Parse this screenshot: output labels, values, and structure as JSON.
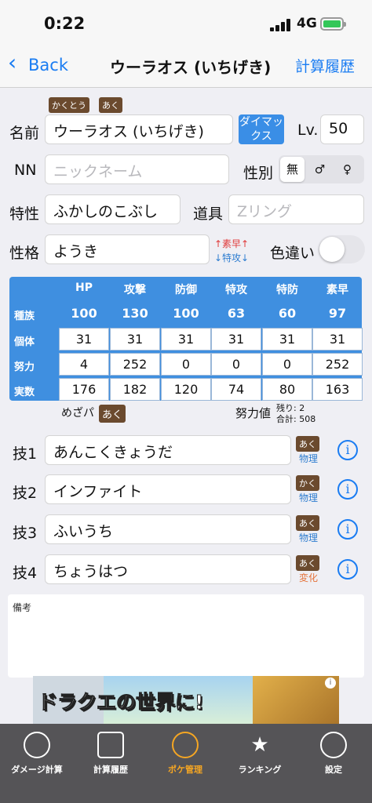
{
  "status": {
    "time": "0:22",
    "network": "4G"
  },
  "nav": {
    "back": "Back",
    "title": "ウーラオス (いちげき)",
    "right": "計算履歴"
  },
  "types": [
    "かくとう",
    "あく"
  ],
  "name": {
    "label": "名前",
    "value": "ウーラオス (いちげき)",
    "dynamax": "ダイマックス",
    "lv_label": "Lv.",
    "lv_value": "50"
  },
  "nick": {
    "label": "NN",
    "placeholder": "ニックネーム",
    "gender_label": "性別",
    "gender_options": [
      "無",
      "♂",
      "♀"
    ],
    "gender_selected": "無"
  },
  "ability": {
    "label": "特性",
    "value": "ふかしのこぶし",
    "item_label": "道具",
    "item_placeholder": "Zリング"
  },
  "nature": {
    "label": "性格",
    "value": "ようき",
    "up": "↑素早↑",
    "down": "↓特攻↓",
    "shiny_label": "色違い",
    "shiny": false
  },
  "stats": {
    "headers": [
      "HP",
      "攻撃",
      "防御",
      "特攻",
      "特防",
      "素早"
    ],
    "rows": [
      {
        "label": "種族",
        "values": [
          "100",
          "130",
          "100",
          "63",
          "60",
          "97"
        ]
      },
      {
        "label": "個体",
        "values": [
          "31",
          "31",
          "31",
          "31",
          "31",
          "31"
        ]
      },
      {
        "label": "努力",
        "values": [
          "4",
          "252",
          "0",
          "0",
          "0",
          "252"
        ]
      },
      {
        "label": "実数",
        "values": [
          "176",
          "182",
          "120",
          "74",
          "80",
          "163"
        ]
      }
    ]
  },
  "hidden_power": {
    "label": "めざパ",
    "type": "あく"
  },
  "ev": {
    "label": "努力値",
    "remaining": "残り: 2",
    "total": "合計: 508"
  },
  "moves": [
    {
      "label": "技1",
      "name": "あんこくきょうだ",
      "type": "あく",
      "category": "物理",
      "category_color": "#2e7dd0"
    },
    {
      "label": "技2",
      "name": "インファイト",
      "type": "かく",
      "category": "物理",
      "category_color": "#2e7dd0"
    },
    {
      "label": "技3",
      "name": "ふいうち",
      "type": "あく",
      "category": "物理",
      "category_color": "#2e7dd0"
    },
    {
      "label": "技4",
      "name": "ちょうはつ",
      "type": "あく",
      "category": "変化",
      "category_color": "#e5733b"
    }
  ],
  "memo": {
    "label": "備考"
  },
  "ad": {
    "text": "ドラクエの世界に!"
  },
  "tabs": [
    {
      "label": "ダメージ計算",
      "active": false
    },
    {
      "label": "計算履歴",
      "active": false
    },
    {
      "label": "ポケ管理",
      "active": true
    },
    {
      "label": "ランキング",
      "active": false
    },
    {
      "label": "設定",
      "active": false
    }
  ],
  "colors": {
    "accent": "#1a7cf2",
    "type_badge": "#6b4a2e",
    "stats_bg": "#3f8fe0",
    "active_tab": "#f5a623"
  }
}
